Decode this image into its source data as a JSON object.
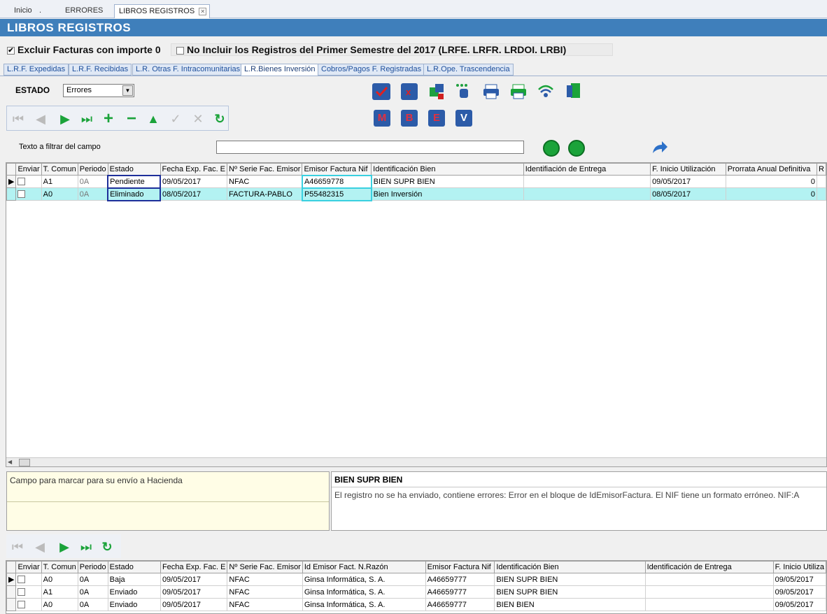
{
  "tabs": [
    "Inicio",
    ".",
    "ERRORES",
    "LIBROS REGISTROS"
  ],
  "title": "LIBROS REGISTROS",
  "options": {
    "excluir": "Excluir Facturas con importe 0",
    "no_incluir": "No Incluir los Registros del Primer Semestre del 2017 (LRFE. LRFR. LRDOI. LRBI)"
  },
  "subtabs": [
    "L.R.F. Expedidas",
    "L.R.F. Recibidas",
    "L.R. Otras F. Intracomunitarias",
    "L.R.Bienes Inversión",
    "Cobros/Pagos F. Registradas",
    "L.R.Ope. Trascendencia"
  ],
  "estado": {
    "label": "ESTADO",
    "value": "Errores"
  },
  "toolbar_letters": [
    "M",
    "B",
    "E",
    "V"
  ],
  "filter": {
    "label": "Texto a filtrar del campo",
    "value": ""
  },
  "main_grid": {
    "headers": [
      "Enviar",
      "T. Comun",
      "Periodo",
      "Estado",
      "Fecha Exp. Fac. E",
      "Nº Serie Fac. Emisor",
      "Emisor Factura Nif",
      "Identificación Bien",
      "Identifiación de Entrega",
      "F. Inicio Utilización",
      "Prorrata Anual Definitiva",
      "R"
    ],
    "rows": [
      [
        "",
        "A1",
        "0A",
        "Pendiente",
        "09/05/2017",
        "NFAC",
        "A46659778",
        "BIEN SUPR BIEN",
        "",
        "09/05/2017",
        "0",
        ""
      ],
      [
        "",
        "A0",
        "0A",
        "Eliminado",
        "08/05/2017",
        "FACTURA-PABLO",
        "P55482315",
        "Bien Inversión",
        "",
        "08/05/2017",
        "0",
        ""
      ]
    ]
  },
  "info": {
    "hint": "Campo para marcar para su envío a Hacienda",
    "record_title": "BIEN SUPR BIEN",
    "record_error": "El registro no se ha enviado, contiene errores: Error en el bloque de IdEmisorFactura. El NIF tiene un formato erróneo. NIF:A"
  },
  "detail_grid": {
    "headers": [
      "Enviar",
      "T. Comun",
      "Periodo",
      "Estado",
      "Fecha Exp. Fac. E",
      "Nº Serie Fac. Emisor",
      "Id Emisor Fact. N.Razón",
      "Emisor Factura Nif",
      "Identificación Bien",
      "Identificación de Entrega",
      "F. Inicio Utiliza"
    ],
    "rows": [
      [
        "",
        "A0",
        "0A",
        "Baja",
        "09/05/2017",
        "NFAC",
        "Ginsa Informática, S. A.",
        "A46659777",
        "BIEN SUPR BIEN",
        "",
        "09/05/2017"
      ],
      [
        "",
        "A1",
        "0A",
        "Enviado",
        "09/05/2017",
        "NFAC",
        "Ginsa Informática, S. A.",
        "A46659777",
        "BIEN SUPR BIEN",
        "",
        "09/05/2017"
      ],
      [
        "",
        "A0",
        "0A",
        "Enviado",
        "09/05/2017",
        "NFAC",
        "Ginsa Informática, S. A.",
        "A46659777",
        "BIEN BIEN",
        "",
        "09/05/2017"
      ]
    ]
  }
}
